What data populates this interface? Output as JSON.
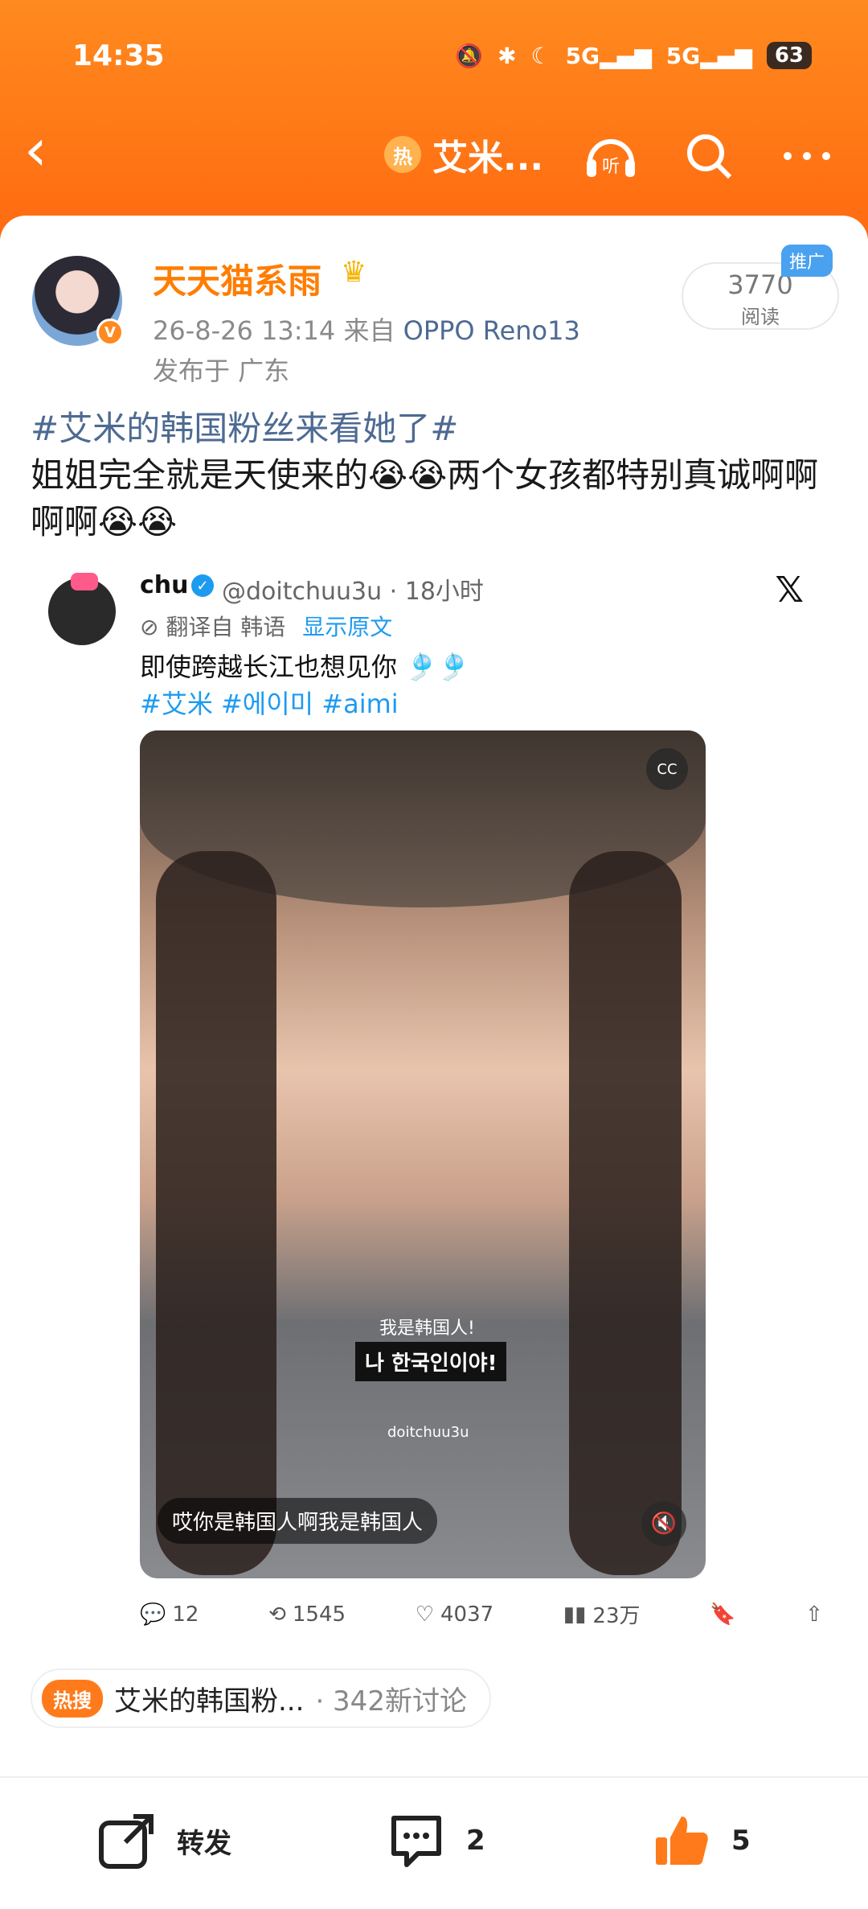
{
  "status_bar": {
    "time": "14:35",
    "network_1": "5G",
    "network_2": "5G",
    "battery": "63"
  },
  "nav": {
    "hot_badge": "热",
    "title": "艾米...",
    "listen_label": "听"
  },
  "post": {
    "username": "天天猫系雨",
    "timestamp": "26-8-26 13:14",
    "source_prefix": "来自",
    "device": "OPPO Reno13",
    "location": "发布于 广东",
    "reads_count": "3770",
    "reads_label": "阅读",
    "promo_label": "推广",
    "hashtag": "#艾米的韩国粉丝来看她了#",
    "body": "姐姐完全就是天使来的😭😭两个女孩都特别真诚啊啊啊啊😭😭"
  },
  "tweet": {
    "name": "chu",
    "handle": "@doitchuu3u · 18小时",
    "translated_from": "翻译自 韩语",
    "show_original": "显示原文",
    "text": "即使跨越长江也想见你",
    "tags": "#艾米 #에이미 #aimi",
    "video": {
      "cc_label": "CC",
      "subtitle_cn": "我是韩国人!",
      "subtitle_kr": "나 한국인이야!",
      "watermark": "doitchuu3u",
      "bottom_caption": "哎你是韩国人啊我是韩国人"
    },
    "actions": {
      "replies": "12",
      "retweets": "1545",
      "likes": "4037",
      "views": "23万"
    }
  },
  "hot_topic": {
    "badge": "热搜",
    "title": "艾米的韩国粉...",
    "count": "· 342新讨论"
  },
  "bottom_bar": {
    "repost_label": "转发",
    "comment_count": "2",
    "like_count": "5"
  },
  "colors": {
    "brand_orange": "#ff7d00",
    "link_blue": "#4d6a92",
    "twitter_blue": "#1d9bf0"
  }
}
